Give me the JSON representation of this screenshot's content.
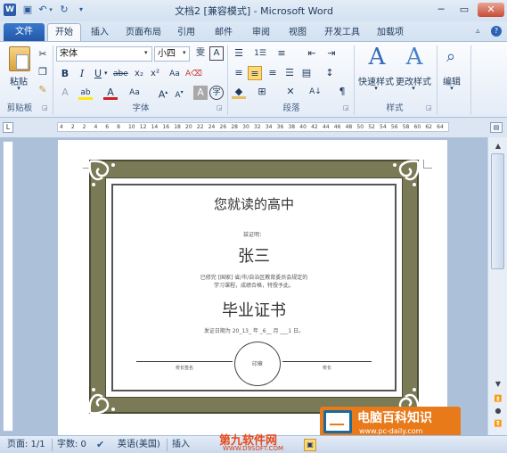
{
  "window": {
    "title": "文档2 [兼容模式] - Microsoft Word"
  },
  "tabs": {
    "file": "文件",
    "items": [
      "开始",
      "插入",
      "页面布局",
      "引用",
      "邮件",
      "审阅",
      "视图",
      "开发工具",
      "加载项"
    ]
  },
  "ribbon": {
    "clipboard": {
      "paste": "粘贴",
      "group": "剪贴板"
    },
    "font": {
      "name": "宋体",
      "size": "小四",
      "group": "字体"
    },
    "paragraph": {
      "group": "段落"
    },
    "styles": {
      "quick": "快速样式",
      "change": "更改样式",
      "group": "样式"
    },
    "editing": {
      "label": "编辑"
    }
  },
  "ruler": {
    "ticks": [
      "4",
      "2",
      "2",
      "4",
      "6",
      "8",
      "10",
      "12",
      "14",
      "16",
      "18",
      "20",
      "22",
      "24",
      "26",
      "28",
      "30",
      "32",
      "34",
      "36",
      "38",
      "40",
      "42",
      "44",
      "46",
      "48",
      "50",
      "52",
      "54",
      "56",
      "58",
      "60",
      "62",
      "64"
    ]
  },
  "certificate": {
    "heading": "您就读的高中",
    "label_name": "兹证明：",
    "name": "张三",
    "body_line1": "已修完 [国家] 省/市/自治区教育委员会规定的",
    "body_line2": "学习课程，成绩合格，特授予此。",
    "title": "毕业证书",
    "date_line": "发证日期为 20_13_ 年 _6__ 月 ___1 日。",
    "sig_left": "校长签名",
    "seal": "印章",
    "sig_right": "校长"
  },
  "statusbar": {
    "page": "页面: 1/1",
    "words": "字数: 0",
    "language": "英语(美国)",
    "insert": "插入"
  },
  "watermark": {
    "brand": "电脑百科知识",
    "url": "www.pc-daily.com",
    "site": "第九软件网",
    "site_url": "WWW.D9SOFT.COM"
  },
  "colors": {
    "frame": "#7a7a56",
    "accent": "#2358a8"
  }
}
